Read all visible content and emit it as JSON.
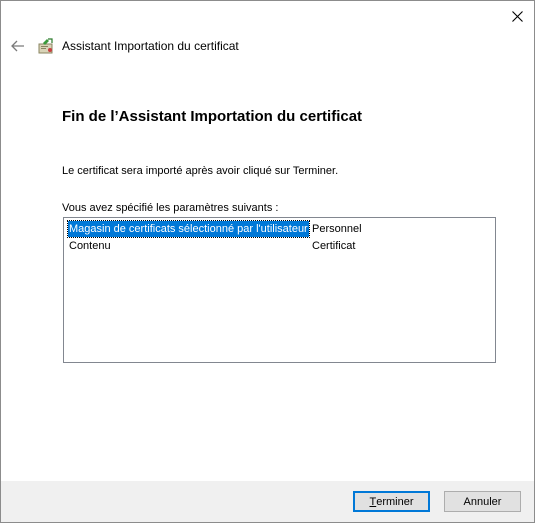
{
  "window": {
    "title": "Assistant Importation du certificat"
  },
  "icons": {
    "close": "close-icon",
    "back": "back-arrow-icon",
    "wizard": "certificate-wizard-icon"
  },
  "content": {
    "heading": "Fin de l’Assistant Importation du certificat",
    "info": "Le certificat sera importé après avoir cliqué sur Terminer.",
    "params_label": "Vous avez spécifié les paramètres suivants :"
  },
  "settings_list": [
    {
      "key": "Magasin de certificats sélectionné par l'utilisateur",
      "value": "Personnel"
    },
    {
      "key": "Contenu",
      "value": "Certificat"
    }
  ],
  "buttons": {
    "finish_first": "T",
    "finish_rest": "erminer",
    "cancel": "Annuler"
  },
  "colors": {
    "selection": "#0078d7",
    "primary_border": "#0078d7",
    "footer_bg": "#f0f0f0"
  }
}
